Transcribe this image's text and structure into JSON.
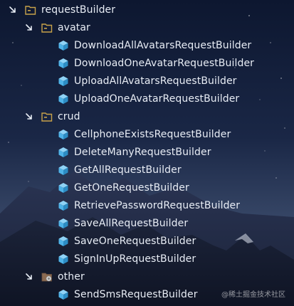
{
  "tree": [
    {
      "label": "requestBuilder",
      "kind": "folder",
      "depth": 0,
      "expanded": true
    },
    {
      "label": "avatar",
      "kind": "folder",
      "depth": 1,
      "expanded": true
    },
    {
      "label": "DownloadAllAvatarsRequestBuilder",
      "kind": "class",
      "depth": 2
    },
    {
      "label": "DownloadOneAvatarRequestBuilder",
      "kind": "class",
      "depth": 2
    },
    {
      "label": "UploadAllAvatarsRequestBuilder",
      "kind": "class",
      "depth": 2
    },
    {
      "label": "UploadOneAvatarRequestBuilder",
      "kind": "class",
      "depth": 2
    },
    {
      "label": "crud",
      "kind": "folder",
      "depth": 1,
      "expanded": true
    },
    {
      "label": "CellphoneExistsRequestBuilder",
      "kind": "class",
      "depth": 2
    },
    {
      "label": "DeleteManyRequestBuilder",
      "kind": "class",
      "depth": 2
    },
    {
      "label": "GetAllRequestBuilder",
      "kind": "class",
      "depth": 2
    },
    {
      "label": "GetOneRequestBuilder",
      "kind": "class",
      "depth": 2
    },
    {
      "label": "RetrievePasswordRequestBuilder",
      "kind": "class",
      "depth": 2
    },
    {
      "label": "SaveAllRequestBuilder",
      "kind": "class",
      "depth": 2
    },
    {
      "label": "SaveOneRequestBuilder",
      "kind": "class",
      "depth": 2
    },
    {
      "label": "SignInUpRequestBuilder",
      "kind": "class",
      "depth": 2
    },
    {
      "label": "other",
      "kind": "folder-special",
      "depth": 1,
      "expanded": true
    },
    {
      "label": "SendSmsRequestBuilder",
      "kind": "class",
      "depth": 2
    }
  ],
  "watermark": "@稀土掘金技术社区",
  "colors": {
    "text": "#e8edf5",
    "class_icon": "#4fb3e8",
    "folder_icon": "#c7a24a",
    "special_folder_icon": "#8a6a52"
  },
  "icons": {
    "folder": "folder-icon",
    "folder-special": "folder-special-icon",
    "class": "class-cube-icon",
    "expand": "chevron-expanded-icon"
  }
}
